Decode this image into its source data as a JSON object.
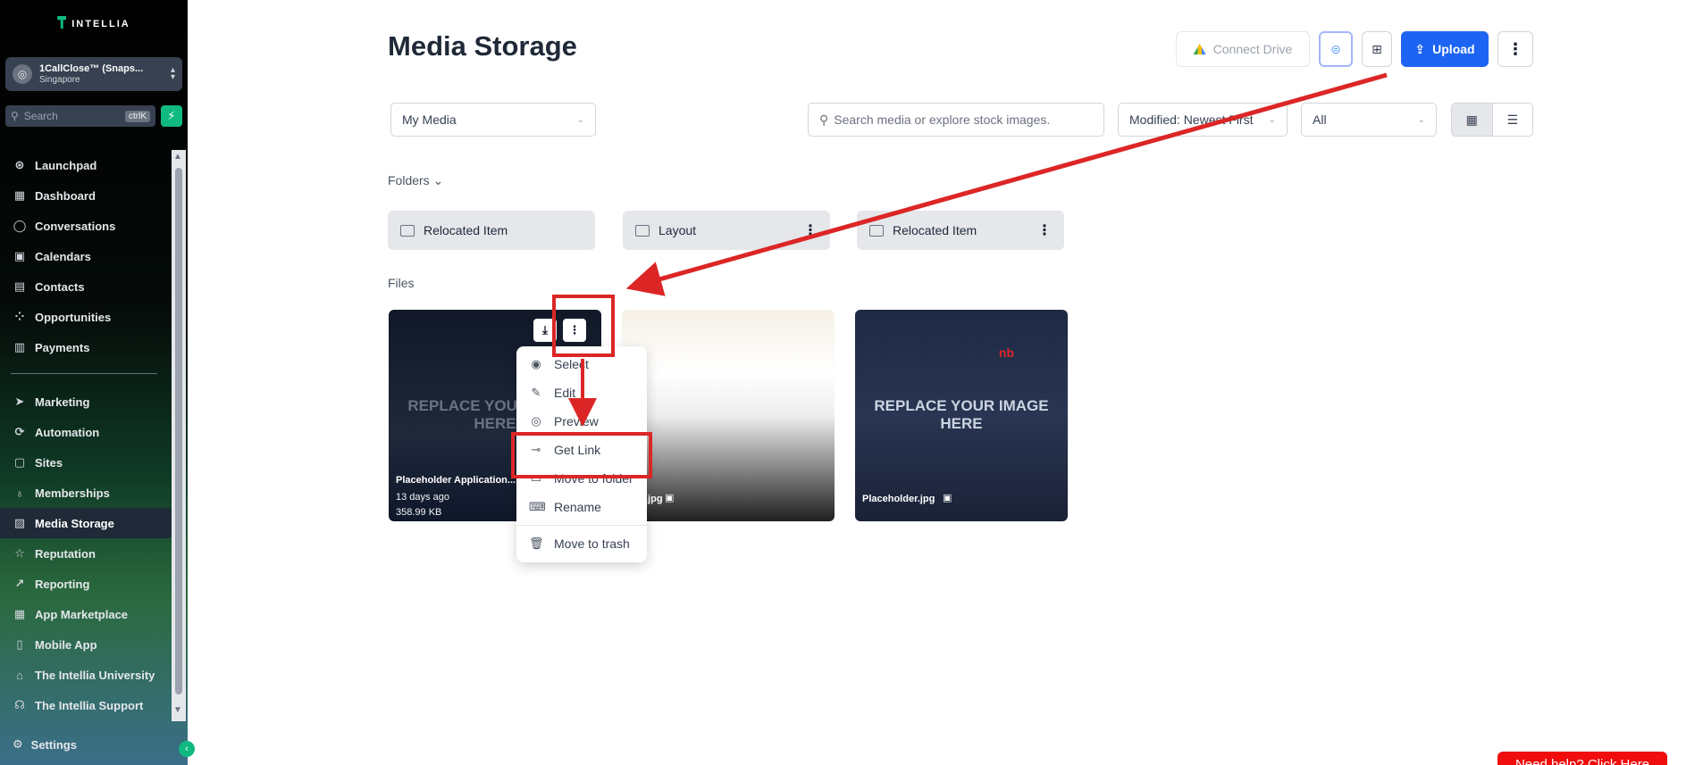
{
  "sidebar": {
    "brand": "INTELLIA",
    "account": {
      "name": "1CallClose™ (Snaps...",
      "location": "Singapore"
    },
    "search": {
      "placeholder": "Search",
      "shortcut": "ctrlK"
    },
    "nav_group_1": [
      {
        "label": "Launchpad",
        "icon": "rocket-icon"
      },
      {
        "label": "Dashboard",
        "icon": "grid-icon"
      },
      {
        "label": "Conversations",
        "icon": "chat-icon"
      },
      {
        "label": "Calendars",
        "icon": "calendar-icon"
      },
      {
        "label": "Contacts",
        "icon": "contacts-icon"
      },
      {
        "label": "Opportunities",
        "icon": "opportunities-icon"
      },
      {
        "label": "Payments",
        "icon": "payments-icon"
      }
    ],
    "nav_group_2": [
      {
        "label": "Marketing",
        "icon": "send-icon"
      },
      {
        "label": "Automation",
        "icon": "automation-icon"
      },
      {
        "label": "Sites",
        "icon": "sites-icon"
      },
      {
        "label": "Memberships",
        "icon": "memberships-icon"
      },
      {
        "label": "Media Storage",
        "icon": "image-icon",
        "active": true
      },
      {
        "label": "Reputation",
        "icon": "star-icon"
      },
      {
        "label": "Reporting",
        "icon": "trend-icon"
      },
      {
        "label": "App Marketplace",
        "icon": "apps-icon"
      },
      {
        "label": "Mobile App",
        "icon": "mobile-icon"
      },
      {
        "label": "The Intellia University",
        "icon": "graduation-icon"
      },
      {
        "label": "The Intellia Support",
        "icon": "headset-icon"
      }
    ],
    "settings": "Settings"
  },
  "header": {
    "title": "Media Storage",
    "connect_drive": "Connect Drive",
    "upload": "Upload"
  },
  "toolbar": {
    "media_select": "My Media",
    "search_placeholder": "Search media or explore stock images.",
    "sort_select": "Modified: Newest First",
    "type_select": "All"
  },
  "folders": {
    "label": "Folders",
    "items": [
      "Relocated Item",
      "Layout",
      "Relocated Item"
    ]
  },
  "files": {
    "label": "Files",
    "items": [
      {
        "name": "Placeholder Application...",
        "modified": "13 days ago",
        "size": "358.99 KB",
        "overlay": "REPLACE YOUR IMAGE HERE"
      },
      {
        "name": ".jpg"
      },
      {
        "name": "Placeholder.jpg",
        "overlay": "REPLACE YOUR IMAGE HERE"
      }
    ]
  },
  "context_menu": {
    "items": [
      "Select",
      "Edit",
      "Preview",
      "Get Link",
      "Move to folder",
      "Rename",
      "Move to trash"
    ]
  },
  "help_button": "Need help? Click Here",
  "colors": {
    "primary": "#1d64f2",
    "accent": "#10b981",
    "annotation": "#dc2626",
    "help": "#ef0d0d"
  }
}
